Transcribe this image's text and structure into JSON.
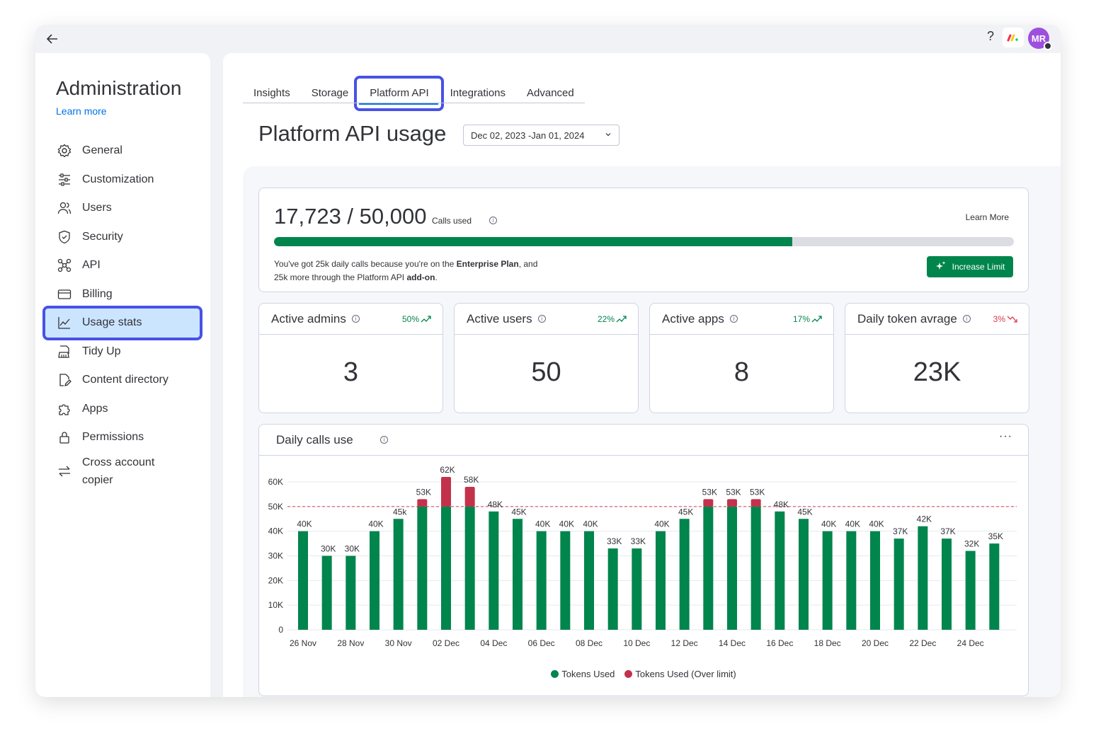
{
  "topbar": {
    "help": "?",
    "avatar": "MR"
  },
  "sidebar": {
    "title": "Administration",
    "learn_more": "Learn more",
    "items": [
      {
        "label": "General",
        "icon": "gear-icon"
      },
      {
        "label": "Customization",
        "icon": "sliders-icon"
      },
      {
        "label": "Users",
        "icon": "users-icon"
      },
      {
        "label": "Security",
        "icon": "shield-icon"
      },
      {
        "label": "API",
        "icon": "api-icon"
      },
      {
        "label": "Billing",
        "icon": "credit-card-icon"
      },
      {
        "label": "Usage stats",
        "icon": "chart-line-icon"
      },
      {
        "label": "Tidy Up",
        "icon": "broom-icon"
      },
      {
        "label": "Content directory",
        "icon": "file-edit-icon"
      },
      {
        "label": "Apps",
        "icon": "puzzle-icon"
      },
      {
        "label": "Permissions",
        "icon": "lock-icon"
      },
      {
        "label": "Cross account copier",
        "icon": "transfer-icon"
      }
    ],
    "active_index": 6
  },
  "tabs": [
    "Insights",
    "Storage",
    "Platform API",
    "Integrations",
    "Advanced"
  ],
  "active_tab": "Platform API",
  "page_title": "Platform API usage",
  "date_range": "Dec 02, 2023 -Jan 01, 2024",
  "calls": {
    "used_text": "17,723 / 50,000",
    "used": 17723,
    "limit": 50000,
    "bar_fraction": 0.7,
    "label": "Calls used",
    "learn_more": "Learn More",
    "desc_1": "You've got 25k daily calls because you're on the ",
    "desc_plan": "Enterprise Plan",
    "desc_2": ", and",
    "desc_3": "25k more through the Platform API ",
    "desc_addon": "add-on",
    "desc_4": ".",
    "button": "Increase Limit"
  },
  "stats": [
    {
      "title": "Active admins",
      "pct": "50%",
      "trend": "up",
      "value": "3"
    },
    {
      "title": "Active users",
      "pct": "22%",
      "trend": "up",
      "value": "50"
    },
    {
      "title": "Active apps",
      "pct": "17%",
      "trend": "up",
      "value": "8"
    },
    {
      "title": "Daily token avrage",
      "pct": "3%",
      "trend": "down",
      "value": "23K"
    }
  ],
  "colors": {
    "green": "#00854d",
    "red": "#c4314b",
    "accent": "#4752e6",
    "link": "#0073ea"
  },
  "chart_data": {
    "type": "bar",
    "title": "Daily calls use",
    "limit": 50000,
    "ylim": [
      0,
      60000
    ],
    "yticks": [
      "0",
      "10K",
      "20K",
      "30K",
      "40K",
      "50K",
      "60K"
    ],
    "xtick_labels": [
      "26 Nov",
      "28 Nov",
      "30 Nov",
      "02 Dec",
      "04 Dec",
      "06 Dec",
      "08 Dec",
      "10 Dec",
      "12 Dec",
      "14 Dec",
      "16 Dec",
      "18 Dec",
      "20 Dec",
      "22 Dec",
      "24 Dec"
    ],
    "values": [
      40000,
      30000,
      30000,
      40000,
      45000,
      53000,
      62000,
      58000,
      48000,
      45000,
      40000,
      40000,
      40000,
      33000,
      33000,
      40000,
      45000,
      53000,
      53000,
      53000,
      48000,
      45000,
      40000,
      40000,
      40000,
      37000,
      42000,
      37000,
      32000,
      35000
    ],
    "data_labels": [
      "40K",
      "30K",
      "30K",
      "40K",
      "45k",
      "53K",
      "62K",
      "58K",
      "48K",
      "45K",
      "40K",
      "40K",
      "40K",
      "33K",
      "33K",
      "40K",
      "45K",
      "53K",
      "53K",
      "53K",
      "48K",
      "45K",
      "40K",
      "40K",
      "40K",
      "37K",
      "42K",
      "37K",
      "32K",
      "35K"
    ],
    "series": [
      {
        "name": "Tokens Used",
        "color": "#00854d"
      },
      {
        "name": "Tokens Used (Over limit)",
        "color": "#c4314b"
      }
    ]
  }
}
